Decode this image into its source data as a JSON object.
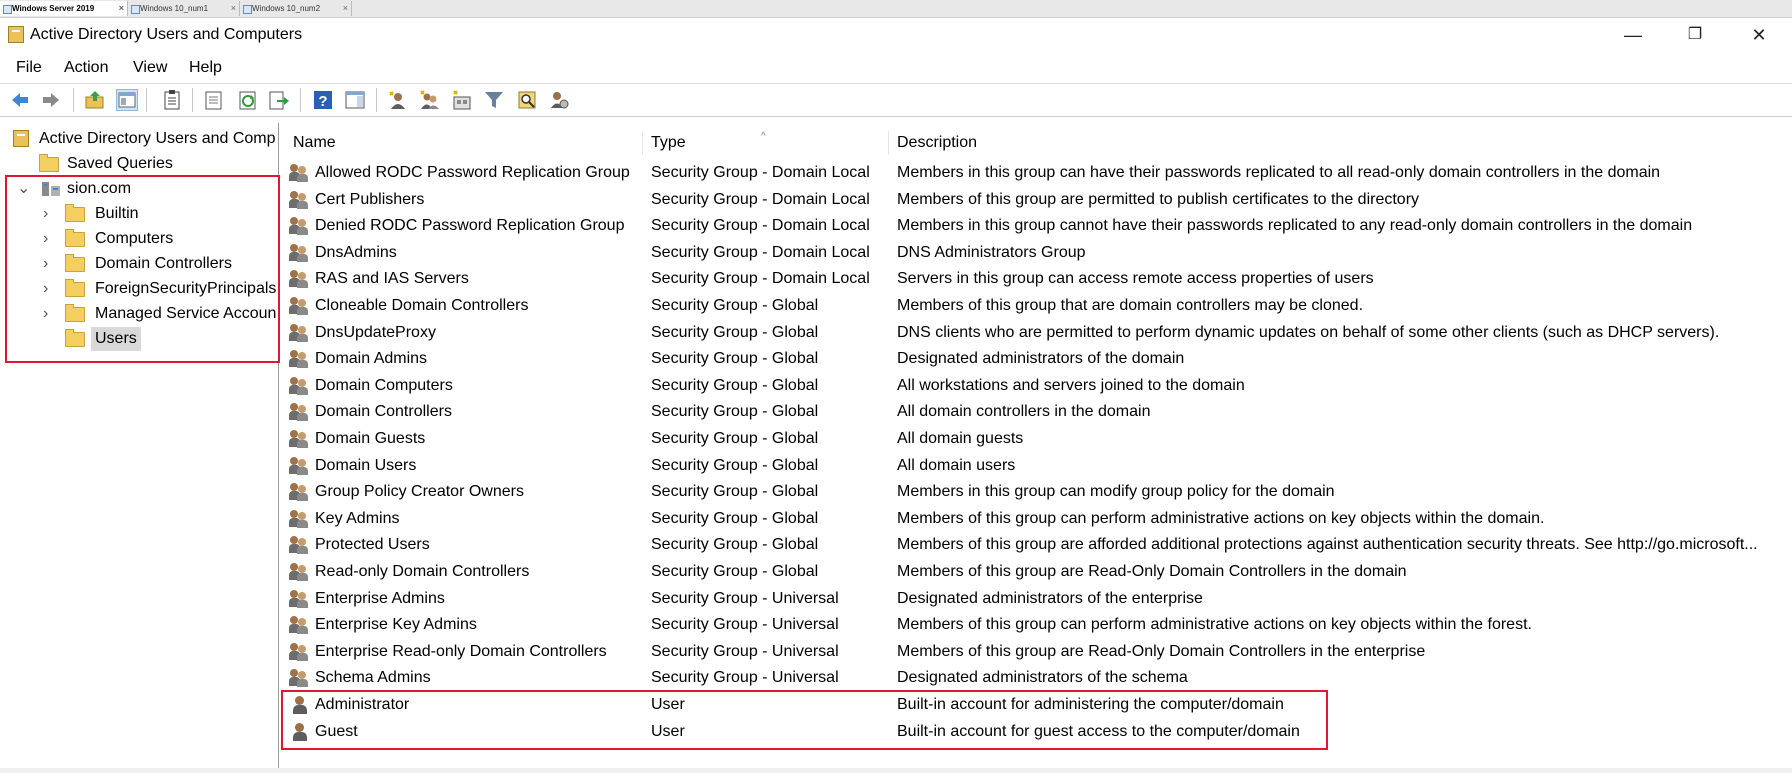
{
  "vm_tabs": [
    {
      "label": "Windows Server 2019",
      "close": "×"
    },
    {
      "label": "Windows 10_num1",
      "close": "×"
    },
    {
      "label": "Windows 10_num2",
      "close": "×"
    }
  ],
  "window": {
    "title": "Active Directory Users and Computers",
    "minimize": "—",
    "restore": "❐",
    "close": "✕"
  },
  "menu": [
    "File",
    "Action",
    "View",
    "Help"
  ],
  "toolbar_icons": [
    "back-arrow-icon",
    "forward-arrow-icon",
    "up-folder-icon",
    "show-hide-console-tree-icon",
    "clipboard-icon",
    "properties-icon",
    "refresh-icon",
    "export-list-icon",
    "help-icon",
    "show-action-pane-icon",
    "new-user-icon",
    "new-group-icon",
    "new-ou-icon",
    "filter-icon",
    "find-icon",
    "add-to-group-icon"
  ],
  "tree": {
    "root": "Active Directory Users and Comp",
    "saved_queries": "Saved Queries",
    "domain": "sion.com",
    "children": [
      "Builtin",
      "Computers",
      "Domain Controllers",
      "ForeignSecurityPrincipals",
      "Managed Service Accoun",
      "Users"
    ],
    "expand_glyph": "›",
    "collapse_glyph": "⌄"
  },
  "columns": {
    "name": "Name",
    "type": "Type",
    "description": "Description",
    "sort_indicator": "^"
  },
  "rows": [
    {
      "name": "Allowed RODC Password Replication Group",
      "type": "Security Group - Domain Local",
      "description": "Members in this group can have their passwords replicated to all read-only domain controllers in the domain",
      "kind": "group"
    },
    {
      "name": "Cert Publishers",
      "type": "Security Group - Domain Local",
      "description": "Members of this group are permitted to publish certificates to the directory",
      "kind": "group"
    },
    {
      "name": "Denied RODC Password Replication Group",
      "type": "Security Group - Domain Local",
      "description": "Members in this group cannot have their passwords replicated to any read-only domain controllers in the domain",
      "kind": "group"
    },
    {
      "name": "DnsAdmins",
      "type": "Security Group - Domain Local",
      "description": "DNS Administrators Group",
      "kind": "group"
    },
    {
      "name": "RAS and IAS Servers",
      "type": "Security Group - Domain Local",
      "description": "Servers in this group can access remote access properties of users",
      "kind": "group"
    },
    {
      "name": "Cloneable Domain Controllers",
      "type": "Security Group - Global",
      "description": "Members of this group that are domain controllers may be cloned.",
      "kind": "group"
    },
    {
      "name": "DnsUpdateProxy",
      "type": "Security Group - Global",
      "description": "DNS clients who are permitted to perform dynamic updates on behalf of some other clients (such as DHCP servers).",
      "kind": "group"
    },
    {
      "name": "Domain Admins",
      "type": "Security Group - Global",
      "description": "Designated administrators of the domain",
      "kind": "group"
    },
    {
      "name": "Domain Computers",
      "type": "Security Group - Global",
      "description": "All workstations and servers joined to the domain",
      "kind": "group"
    },
    {
      "name": "Domain Controllers",
      "type": "Security Group - Global",
      "description": "All domain controllers in the domain",
      "kind": "group"
    },
    {
      "name": "Domain Guests",
      "type": "Security Group - Global",
      "description": "All domain guests",
      "kind": "group"
    },
    {
      "name": "Domain Users",
      "type": "Security Group - Global",
      "description": "All domain users",
      "kind": "group"
    },
    {
      "name": "Group Policy Creator Owners",
      "type": "Security Group - Global",
      "description": "Members in this group can modify group policy for the domain",
      "kind": "group"
    },
    {
      "name": "Key Admins",
      "type": "Security Group - Global",
      "description": "Members of this group can perform administrative actions on key objects within the domain.",
      "kind": "group"
    },
    {
      "name": "Protected Users",
      "type": "Security Group - Global",
      "description": "Members of this group are afforded additional protections against authentication security threats. See http://go.microsoft...",
      "kind": "group"
    },
    {
      "name": "Read-only Domain Controllers",
      "type": "Security Group - Global",
      "description": "Members of this group are Read-Only Domain Controllers in the domain",
      "kind": "group"
    },
    {
      "name": "Enterprise Admins",
      "type": "Security Group - Universal",
      "description": "Designated administrators of the enterprise",
      "kind": "group"
    },
    {
      "name": "Enterprise Key Admins",
      "type": "Security Group - Universal",
      "description": "Members of this group can perform administrative actions on key objects within the forest.",
      "kind": "group"
    },
    {
      "name": "Enterprise Read-only Domain Controllers",
      "type": "Security Group - Universal",
      "description": "Members of this group are Read-Only Domain Controllers in the enterprise",
      "kind": "group"
    },
    {
      "name": "Schema Admins",
      "type": "Security Group - Universal",
      "description": "Designated administrators of the schema",
      "kind": "group"
    },
    {
      "name": "Administrator",
      "type": "User",
      "description": "Built-in account for administering the computer/domain",
      "kind": "user"
    },
    {
      "name": "Guest",
      "type": "User",
      "description": "Built-in account for guest access to the computer/domain",
      "kind": "user"
    }
  ],
  "colors": {
    "highlight_border": "#e0182f",
    "selection": "#d9d9d9",
    "folder": "#f3cf62"
  }
}
